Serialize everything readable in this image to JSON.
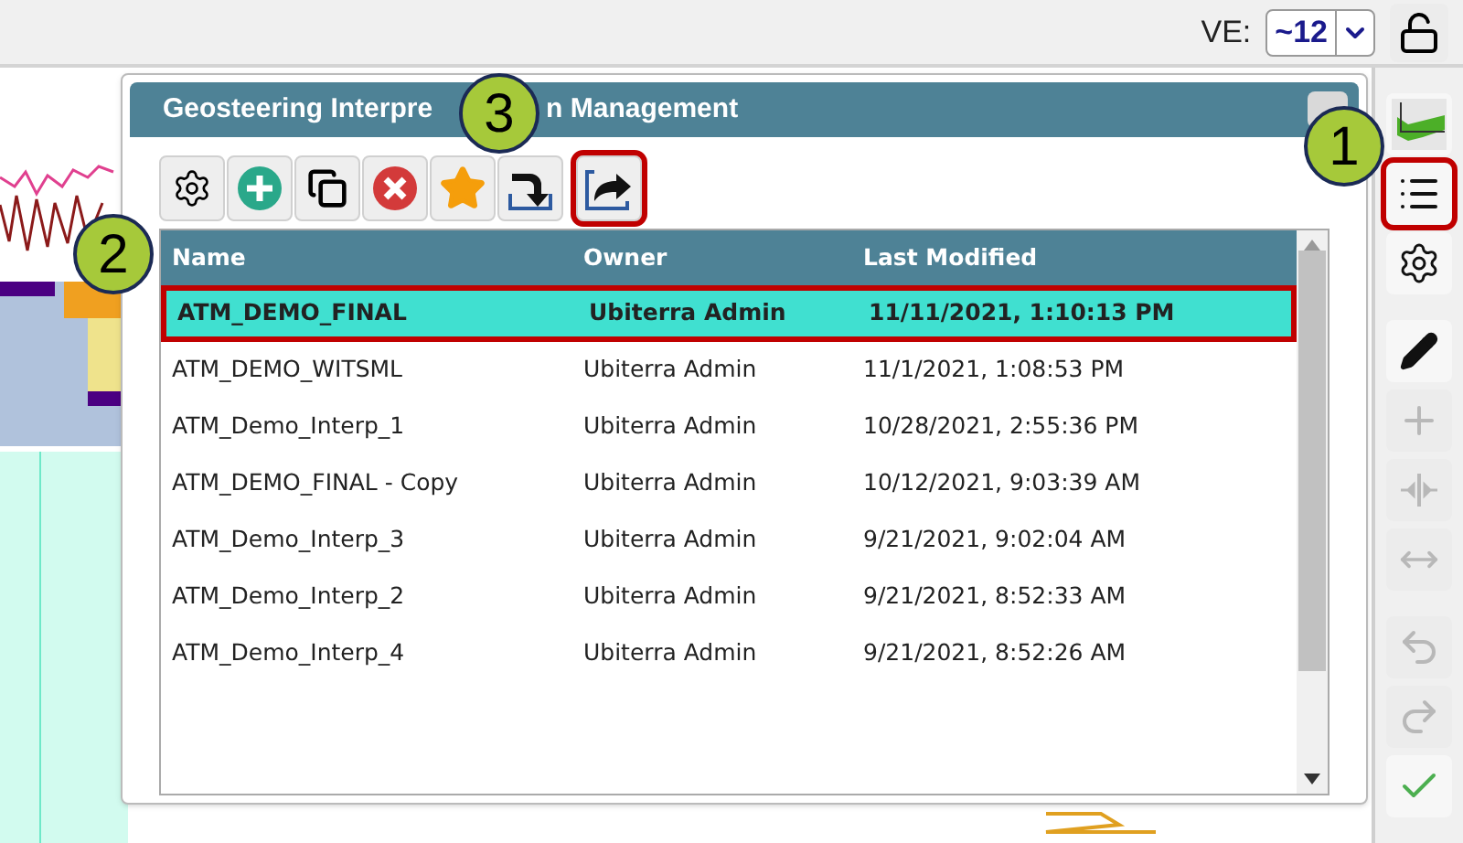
{
  "top_bar": {
    "ve_label": "VE:",
    "ve_value": "~12"
  },
  "dialog": {
    "title_start": "Geosteering Interpre",
    "title_end": "n Management",
    "toolbar": [
      {
        "kind": "settings",
        "highlighted": false
      },
      {
        "kind": "add",
        "highlighted": false
      },
      {
        "kind": "copy",
        "highlighted": false
      },
      {
        "kind": "delete",
        "highlighted": false
      },
      {
        "kind": "favorite",
        "highlighted": false
      },
      {
        "kind": "import",
        "highlighted": false
      },
      {
        "kind": "share",
        "highlighted": true
      }
    ],
    "table": {
      "columns": [
        "Name",
        "Owner",
        "Last Modified"
      ],
      "rows": [
        {
          "cells": [
            "ATM_DEMO_FINAL",
            "Ubiterra Admin",
            "11/11/2021, 1:10:13 PM"
          ],
          "selected": true
        },
        {
          "cells": [
            "ATM_DEMO_WITSML",
            "Ubiterra Admin",
            "11/1/2021, 1:08:53 PM"
          ],
          "selected": false
        },
        {
          "cells": [
            "ATM_Demo_Interp_1",
            "Ubiterra Admin",
            "10/28/2021, 2:55:36 PM"
          ],
          "selected": false
        },
        {
          "cells": [
            "ATM_DEMO_FINAL - Copy",
            "Ubiterra Admin",
            "10/12/2021, 9:03:39 AM"
          ],
          "selected": false
        },
        {
          "cells": [
            "ATM_Demo_Interp_3",
            "Ubiterra Admin",
            "9/21/2021, 9:02:04 AM"
          ],
          "selected": false
        },
        {
          "cells": [
            "ATM_Demo_Interp_2",
            "Ubiterra Admin",
            "9/21/2021, 8:52:33 AM"
          ],
          "selected": false
        },
        {
          "cells": [
            "ATM_Demo_Interp_4",
            "Ubiterra Admin",
            "9/21/2021, 8:52:26 AM"
          ],
          "selected": false
        }
      ]
    }
  },
  "side_toolbar": [
    {
      "kind": "chart",
      "highlighted": false,
      "disabled": false
    },
    {
      "kind": "list",
      "highlighted": true,
      "disabled": false
    },
    {
      "kind": "settings",
      "highlighted": false,
      "disabled": false
    },
    {
      "kind": "pencil",
      "highlighted": false,
      "disabled": false
    },
    {
      "kind": "plus",
      "highlighted": false,
      "disabled": true
    },
    {
      "kind": "split",
      "highlighted": false,
      "disabled": true
    },
    {
      "kind": "stretch",
      "highlighted": false,
      "disabled": true
    },
    {
      "kind": "undo",
      "highlighted": false,
      "disabled": true
    },
    {
      "kind": "redo",
      "highlighted": false,
      "disabled": true
    },
    {
      "kind": "check",
      "highlighted": false,
      "disabled": false
    }
  ],
  "callouts": [
    {
      "number": "1"
    },
    {
      "number": "2"
    },
    {
      "number": "3"
    }
  ]
}
